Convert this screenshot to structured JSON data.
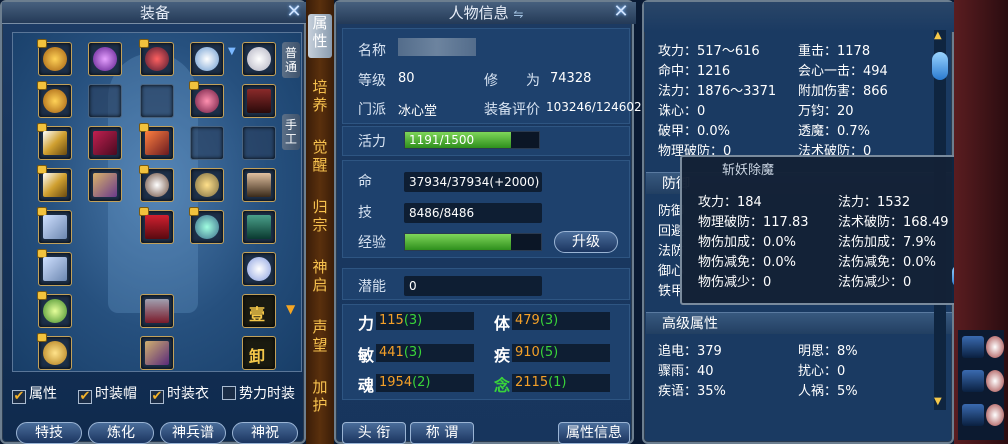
{
  "equipment": {
    "title": "装备",
    "side_tabs": [
      "普通",
      "手工"
    ],
    "equip_slot_left": "壹",
    "equip_slot_unload": "卸",
    "checkboxes": [
      {
        "label": "属性",
        "checked": true
      },
      {
        "label": "时装帽",
        "checked": true
      },
      {
        "label": "时装衣",
        "checked": true
      },
      {
        "label": "势力时装",
        "checked": false
      }
    ],
    "buttons": [
      "特技",
      "炼化",
      "神兵谱",
      "神祝"
    ]
  },
  "side_nav": [
    "属性",
    "培养",
    "觉醒",
    "归宗",
    "神启",
    "声望",
    "加护"
  ],
  "character": {
    "title": "人物信息",
    "name_label": "名称",
    "level_label": "等级",
    "level": "80",
    "cultivation_label": "修　　为",
    "cultivation": "74328",
    "sect_label": "门派",
    "sect": "冰心堂",
    "rating_label": "装备评价",
    "rating": "103246/124602",
    "vitality_label": "活力",
    "vitality": "1191/1500",
    "vitality_ratio": 0.794,
    "hp_label": "命",
    "hp": "37934/37934(+2000)",
    "skill_label": "技",
    "skill": "8486/8486",
    "exp_label": "经验",
    "exp_ratio": 0.78,
    "upgrade_button": "升级",
    "potential_label": "潜能",
    "potential": "0",
    "attributes": [
      {
        "key": "力",
        "base": "115",
        "bonus": "(3)"
      },
      {
        "key": "体",
        "base": "479",
        "bonus": "(3)"
      },
      {
        "key": "敏",
        "base": "441",
        "bonus": "(3)"
      },
      {
        "key": "疾",
        "base": "910",
        "bonus": "(5)"
      },
      {
        "key": "魂",
        "base": "1954",
        "bonus": "(2)"
      },
      {
        "key": "念",
        "base": "2115",
        "bonus": "(1)"
      }
    ],
    "bottom_buttons": [
      "头 衔",
      "称 谓",
      "属性信息"
    ]
  },
  "stats": {
    "rows": [
      [
        "攻力：517～616",
        "重击：1178"
      ],
      [
        "命中：1216",
        "会心一击：494"
      ],
      [
        "法力：1876～3371",
        "附加伤害：866"
      ],
      [
        "诛心：0",
        "万钧：20"
      ],
      [
        "破甲：0.0%",
        "透魔：0.7%"
      ],
      [
        "物理破防：0",
        "法术破防：0"
      ]
    ],
    "defense_head": "防御",
    "defense_partial": [
      "防御",
      "回避",
      "法防",
      "御心",
      "铁甲"
    ],
    "advanced_head": "高级属性",
    "advanced": [
      [
        "追电：379",
        "明思：8%"
      ],
      [
        "骤雨：40",
        "扰心：0"
      ],
      [
        "疾语：35%",
        "人祸：5%"
      ]
    ]
  },
  "tooltip": {
    "title": "斩妖除魔",
    "rows": [
      [
        "攻力：184",
        "法力：1532"
      ],
      [
        "物理破防：117.83",
        "法术破防：168.49"
      ],
      [
        "物伤加成：0.0%",
        "法伤加成：7.9%"
      ],
      [
        "物伤减免：0.0%",
        "法伤减免：0.0%"
      ],
      [
        "物伤减少：0",
        "法伤减少：0"
      ]
    ]
  }
}
